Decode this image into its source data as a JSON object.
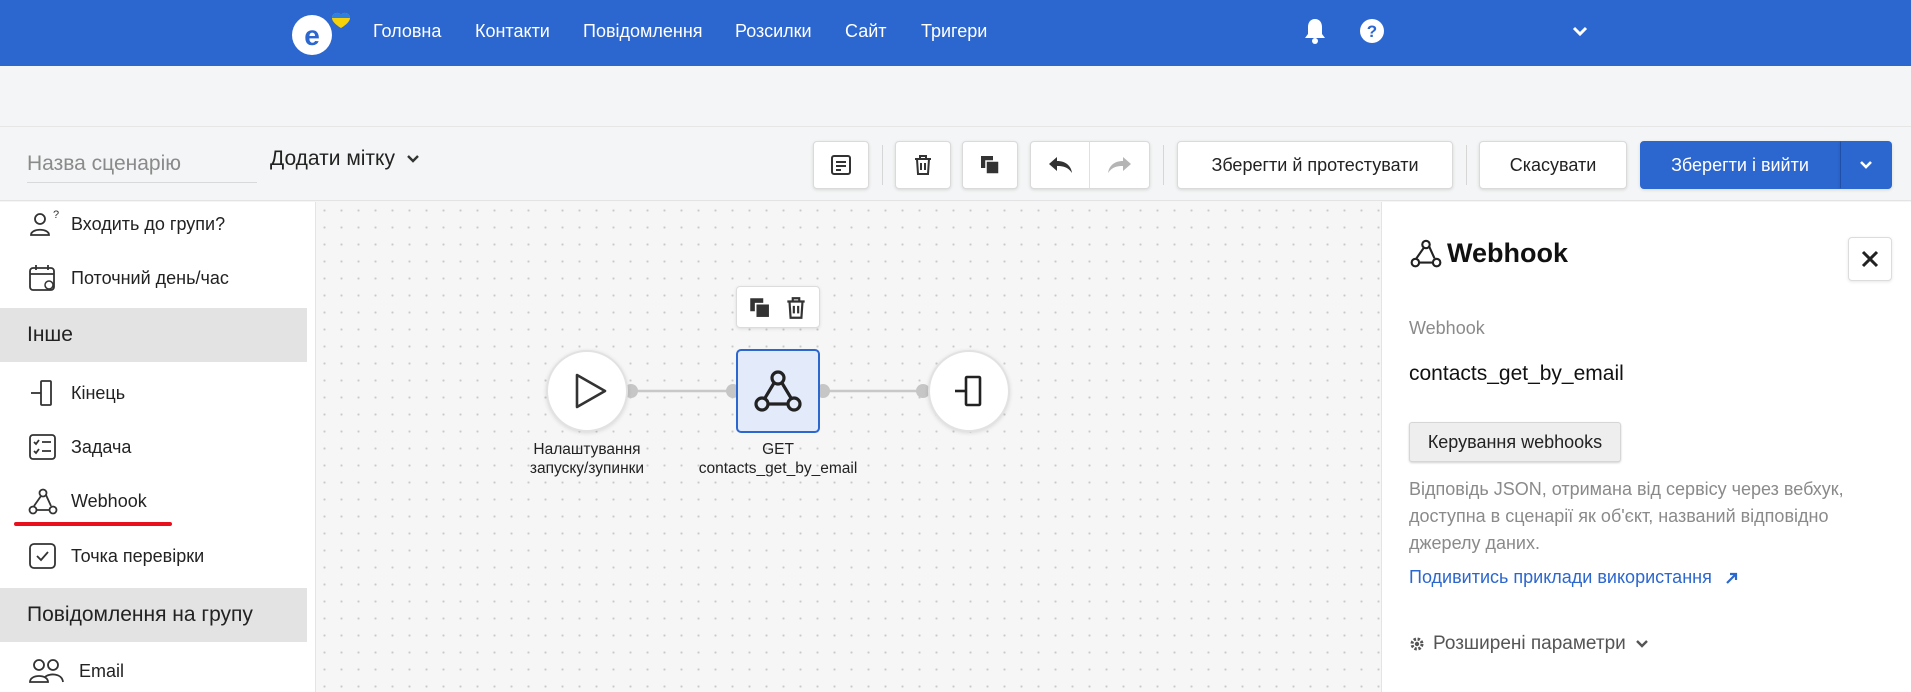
{
  "nav": {
    "items": [
      "Головна",
      "Контакти",
      "Повідомлення",
      "Розсилки",
      "Сайт",
      "Тригери"
    ],
    "icons": [
      "bell-icon",
      "help-icon",
      "chevron-down-icon"
    ]
  },
  "toolbar": {
    "name_placeholder": "Назва сценарію",
    "tag_label": "Додати мітку",
    "save_test_label": "Зберегти й протестувати",
    "cancel_label": "Скасувати",
    "save_exit_label": "Зберегти і вийти"
  },
  "sidebar": {
    "items": [
      {
        "label": "Входить до групи?",
        "icon": "group-question-icon"
      },
      {
        "label": "Поточний день/час",
        "icon": "calendar-clock-icon"
      },
      {
        "label": "Кінець",
        "icon": "end-icon"
      },
      {
        "label": "Задача",
        "icon": "task-list-icon"
      },
      {
        "label": "Webhook",
        "icon": "webhook-icon"
      },
      {
        "label": "Точка перевірки",
        "icon": "checkpoint-icon"
      },
      {
        "label": "Email",
        "icon": "group-email-icon"
      }
    ],
    "sections": [
      "Інше",
      "Повідомлення на групу"
    ]
  },
  "canvas": {
    "start_label_line1": "Налаштування",
    "start_label_line2": "запуску/зупинки",
    "webhook_method": "GET",
    "webhook_name": "contacts_get_by_email"
  },
  "panel": {
    "title": "Webhook",
    "field_label": "Webhook",
    "field_value": "contacts_get_by_email",
    "manage_button": "Керування webhooks",
    "description": "Відповідь JSON, отримана від сервісу через вебхук, доступна в сценарії як об'єкт, названий відповідно джерелу даних.",
    "examples_link": "Подивитись приклади використання",
    "advanced_label": "Розширені параметри"
  },
  "colors": {
    "brand": "#2c66cf",
    "highlight_underline": "#e8101c",
    "logo_heart_top": "#2d7fe0",
    "logo_heart_bottom": "#f5d20a"
  }
}
